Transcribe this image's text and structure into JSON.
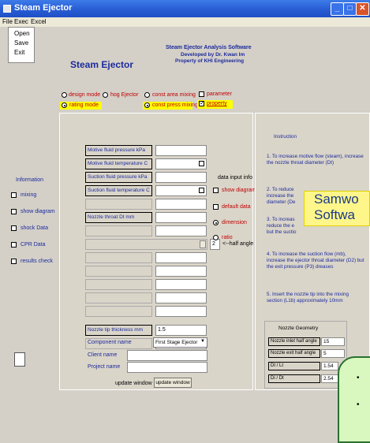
{
  "window": {
    "title": "Steam Ejector"
  },
  "menubar": {
    "items": [
      "File",
      "Exec",
      "Excel"
    ]
  },
  "file_menu": {
    "items": [
      "Open",
      "Save",
      "Exit"
    ]
  },
  "header": {
    "app_title": "Steam Ejector",
    "software_title": "Steam Ejector Analysis Software",
    "developed_by": "Developed by Dr. Kwan Im",
    "property_of": "Property of KHI Engineering"
  },
  "modes": {
    "design_mode": "design mode",
    "hog_ejector": "hog Ejector",
    "const_area_mixing": "const area mixing",
    "parameter": "parameter",
    "rating_mode": "rating mode",
    "const_press_mixing": "const press mixing",
    "property": "property"
  },
  "sidebar": {
    "title": "Information",
    "items": [
      "mixing",
      "show diagram",
      "shock Data",
      "CPR Data",
      "results check"
    ]
  },
  "inputs": {
    "motive_pressure": "Motive fluid pressure     kPa",
    "motive_temperature": "Motive fluid temperature   C",
    "suction_pressure": "Suction fluid pressure kPa",
    "suction_temperature": "Suction fluid temperature  C",
    "nozzle_throat": "Nozzle throat       Dt mm",
    "half_angle_value": "2",
    "half_angle_label": "<--half angle",
    "nozzle_tip_label": "Nozzle tip thickness      mm",
    "nozzle_tip_value": "1.5"
  },
  "data_info": {
    "title": "data input info",
    "show_diagram": "show diagram",
    "default_data": "default data",
    "dimension": "dimension",
    "ratio": "ratio"
  },
  "component": {
    "label": "Component name",
    "selected": "First Stage Ejector",
    "client_label": "Client name",
    "project_label": "Project name",
    "update_text": "update window",
    "update_button": "update window"
  },
  "instruction": {
    "title": "Instruction",
    "p1": "1. To increase motive flow (steam), increase the nozzle throat diameter (Dt)",
    "p2a": "2. To reduce",
    "p2b": "increase the",
    "p2c": "diameter (De",
    "p3a": "3. To increas",
    "p3b": "reduce the e",
    "p3c": "but the suctio",
    "p4": "4. To increase the suction flow (mb), increase the ejector throat diameter (D2) but the exit pressure (P3) dreases",
    "p5": "5. Insert the nozzle tip into the mixing section (L1b) approximately 10mm"
  },
  "nozzle_geometry": {
    "title": "Nozzle Geometry",
    "inlet_label": "Nozzle inlet half angle",
    "inlet_value": "15",
    "exit_label": "Nozzle exit half angle",
    "exit_value": "5",
    "dt_lt_label": "Dt / Lt",
    "dt_lt_value": "1.54",
    "di_dt_label": "Di / Dt",
    "di_dt_value": "2.54"
  },
  "overlay": {
    "line1": "Samwo",
    "line2": "Softwa"
  },
  "bullets": [
    "•",
    "•"
  ]
}
